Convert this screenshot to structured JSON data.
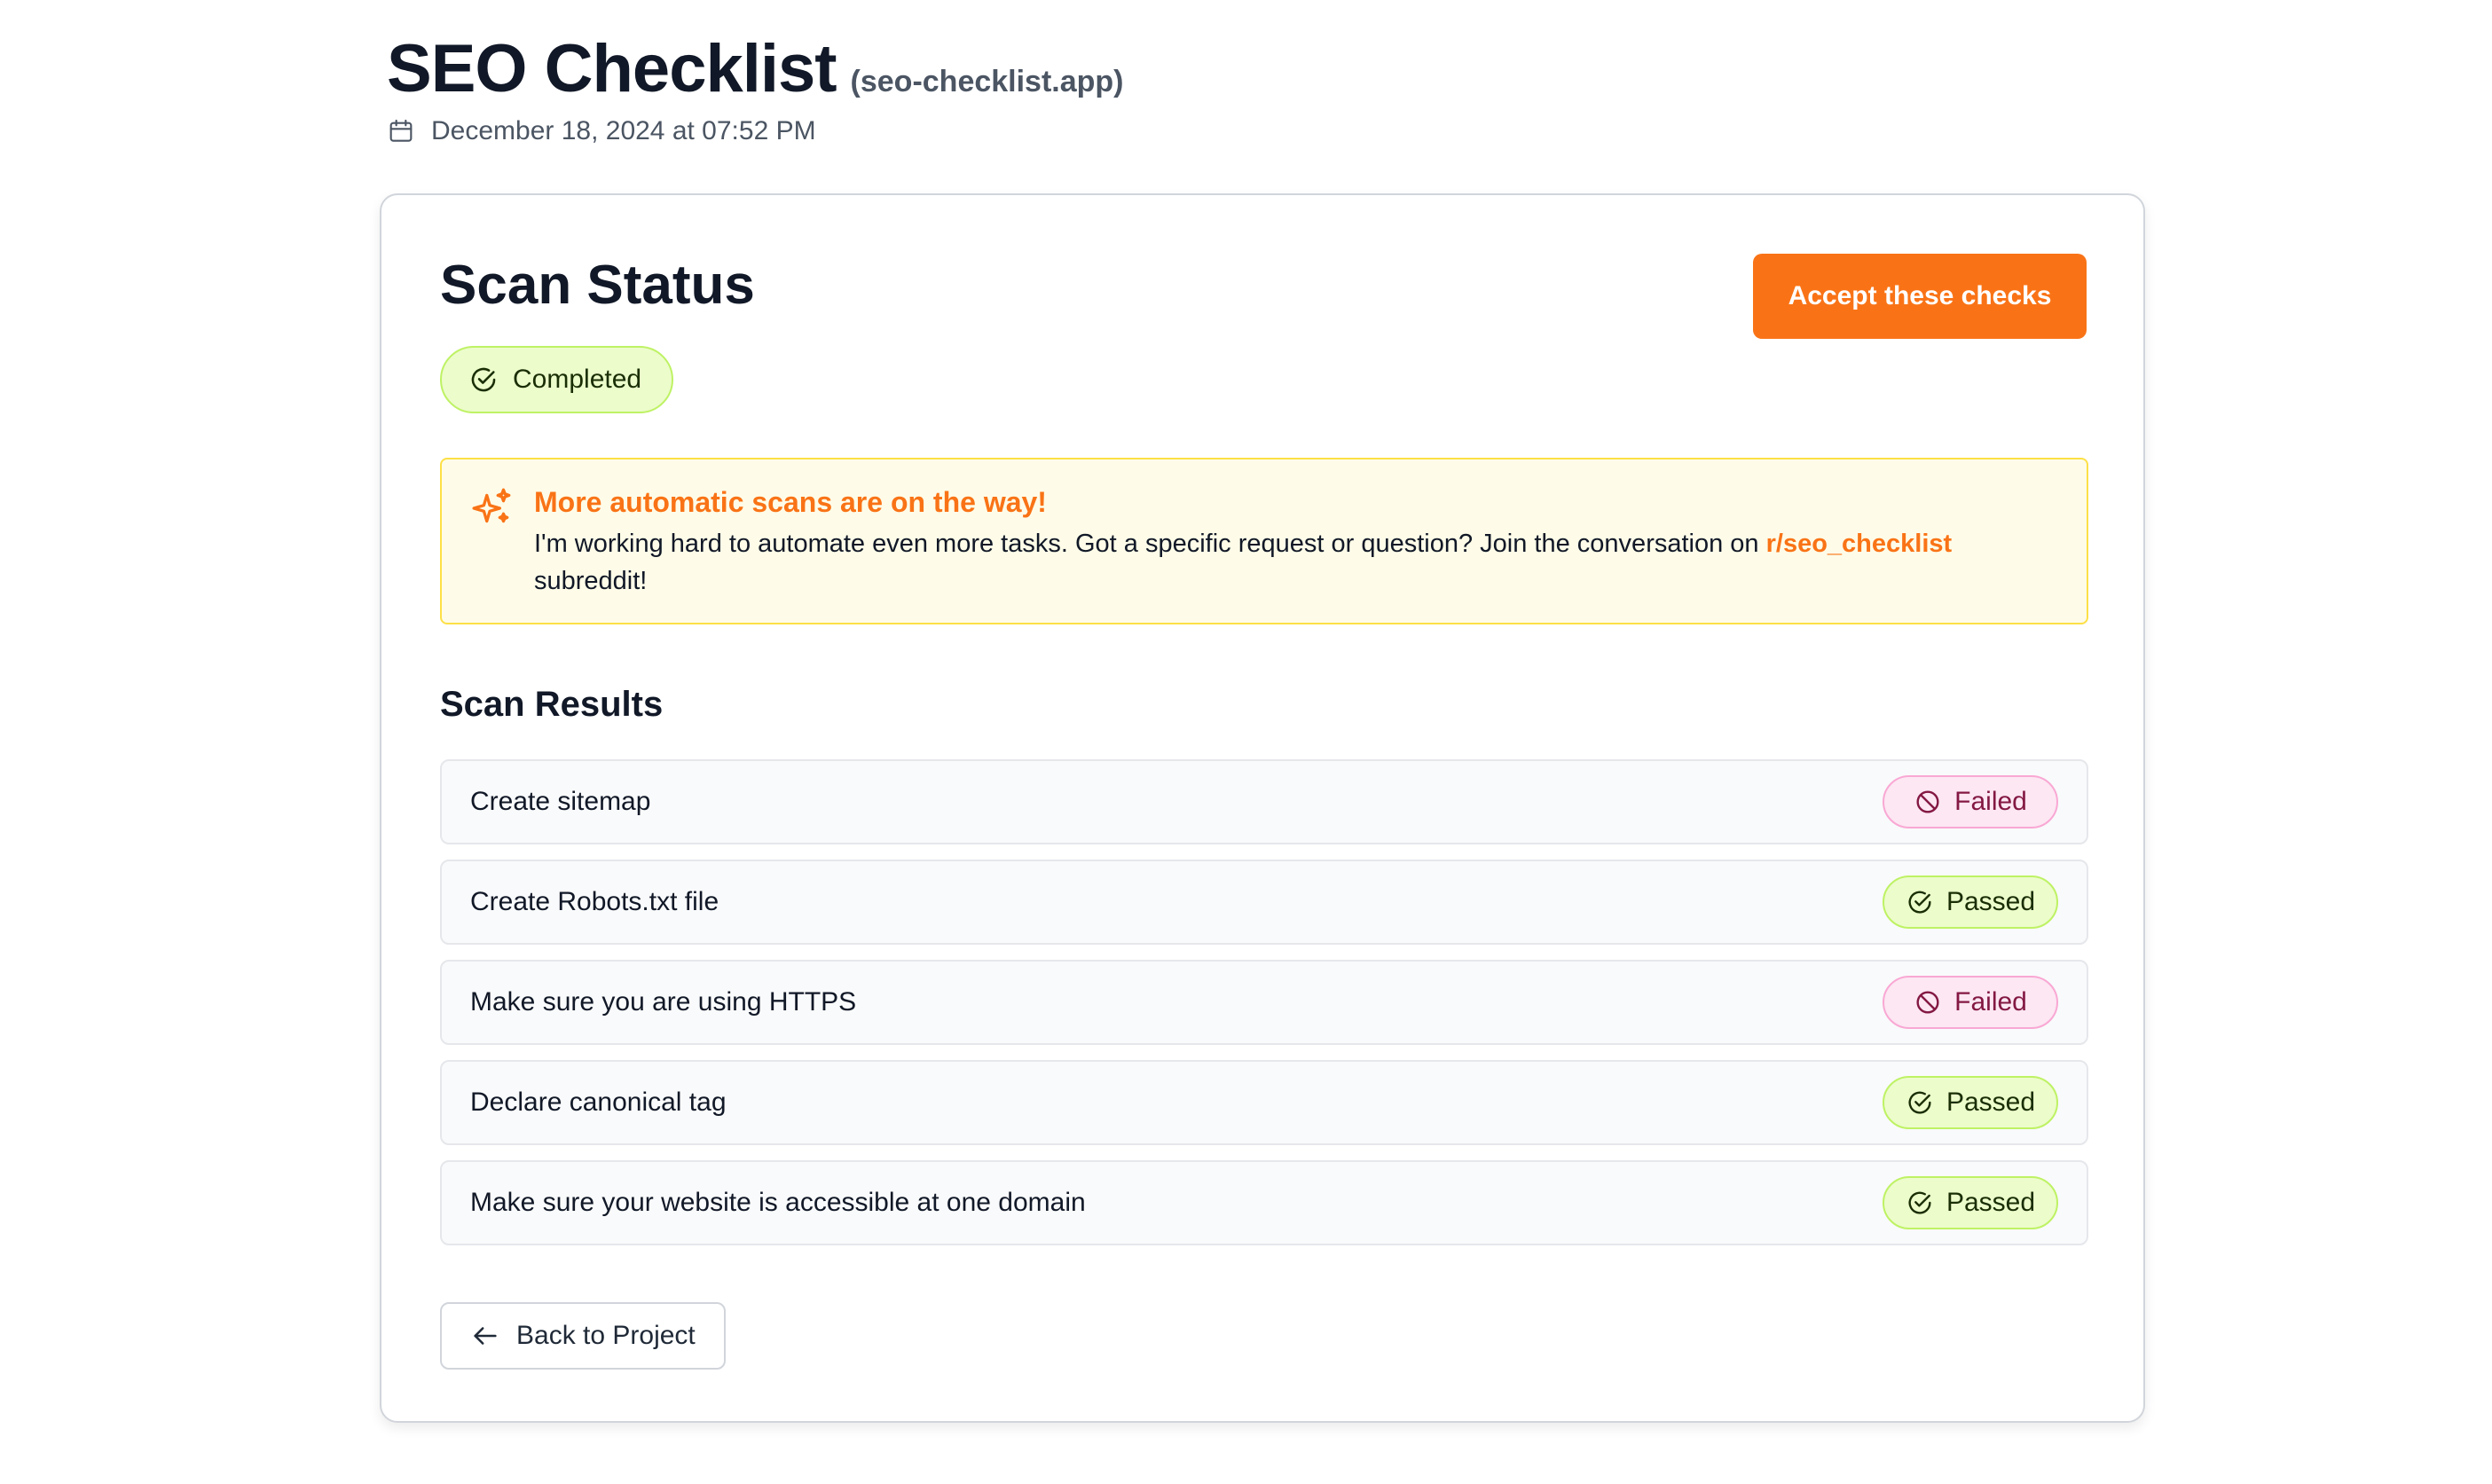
{
  "header": {
    "title": "SEO Checklist",
    "domain": "(seo-checklist.app)",
    "date": "December 18, 2024 at 07:52 PM",
    "date_icon": "calendar-icon"
  },
  "scan_status": {
    "title": "Scan Status",
    "accept_label": "Accept these checks",
    "status_label": "Completed",
    "status_icon": "check-circle-icon"
  },
  "notice": {
    "icon": "sparkles-icon",
    "title": "More automatic scans are on the way!",
    "body_before": "I'm working hard to automate even more tasks. Got a specific request or question? Join the conversation on ",
    "link_text": "r/seo_checklist",
    "body_after": " subreddit!"
  },
  "results": {
    "title": "Scan Results",
    "items": [
      {
        "label": "Create sitemap",
        "status": "Failed",
        "status_type": "failed"
      },
      {
        "label": "Create Robots.txt file",
        "status": "Passed",
        "status_type": "passed"
      },
      {
        "label": "Make sure you are using HTTPS",
        "status": "Failed",
        "status_type": "failed"
      },
      {
        "label": "Declare canonical tag",
        "status": "Passed",
        "status_type": "passed"
      },
      {
        "label": "Make sure your website is accessible at one domain",
        "status": "Passed",
        "status_type": "passed"
      }
    ]
  },
  "footer": {
    "back_label": "Back to Project",
    "back_icon": "arrow-left-icon"
  },
  "colors": {
    "accent": "#f97316",
    "passed_bg": "#ecfccb",
    "failed_bg": "#fce7f3",
    "notice_bg": "#fefce8"
  }
}
